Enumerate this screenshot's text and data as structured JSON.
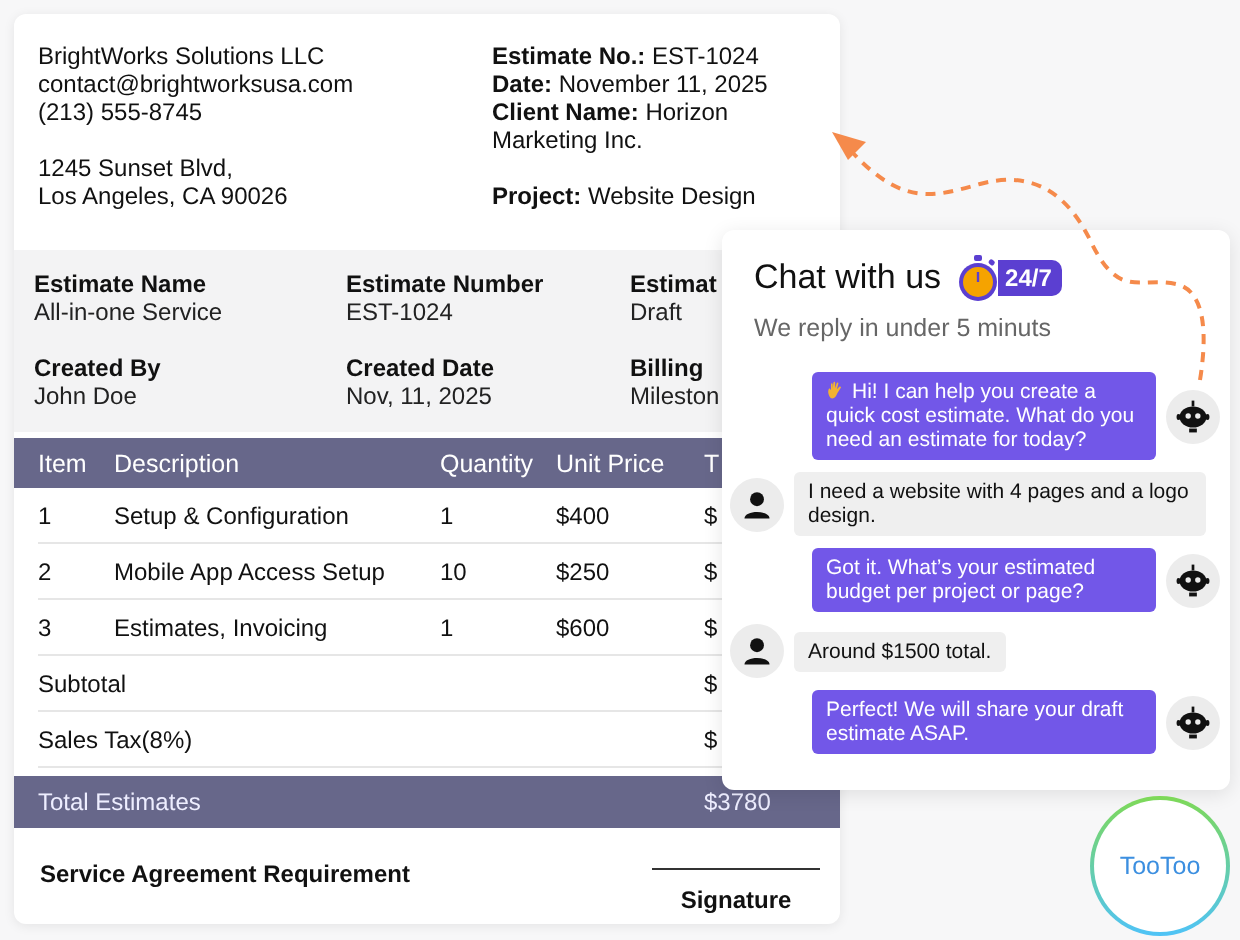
{
  "company": {
    "contact": [
      "BrightWorks Solutions LLC",
      "contact@brightworksusa.com",
      "(213) 555-8745"
    ],
    "address": [
      "1245 Sunset Blvd,",
      "Los Angeles, CA 90026"
    ]
  },
  "estimate_info": [
    "**Estimate No.:** EST-1024",
    "**Date:** November 11, 2025",
    "**Client Name:** Horizon Marketing Inc."
  ],
  "project": "**Project:** Website Design",
  "details": [
    {
      "label": "Estimate Name",
      "value": "All-in-one Service"
    },
    {
      "label": "Estimate Number",
      "value": "EST-1024"
    },
    {
      "label": "Estimat",
      "value": "Draft"
    },
    {
      "label": "Created By",
      "value": "John Doe"
    },
    {
      "label": "Created Date",
      "value": "Nov, 11, 2025"
    },
    {
      "label": "Billing",
      "value": "Mileston"
    }
  ],
  "table": {
    "columns": [
      "Item",
      "Description",
      "Quantity",
      "Unit Price",
      "T"
    ],
    "rows": [
      [
        "1",
        "Setup & Configuration",
        "1",
        "$400",
        "$"
      ],
      [
        "2",
        "Mobile App Access Setup",
        "10",
        "$250",
        "$"
      ],
      [
        "3",
        "Estimates, Invoicing",
        "1",
        "$600",
        "$"
      ]
    ],
    "summary": [
      {
        "label": "Subtotal",
        "value": "$"
      },
      {
        "label": "Sales Tax(8%)",
        "value": "$"
      }
    ],
    "total": {
      "label": "Total Estimates",
      "value": "$3780"
    }
  },
  "footer": {
    "requirement": "Service Agreement Requirement",
    "signature": "Signature"
  },
  "chat": {
    "title": "Chat with us",
    "badge": "24/7",
    "subtitle": "We reply in under 5 minuts",
    "messages": [
      {
        "kind": "bot",
        "greeting": true,
        "text": "Hi! I can help you create a quick cost estimate. What do you need an estimate for today?"
      },
      {
        "kind": "user",
        "text": "I need a website with 4 pages and a logo design."
      },
      {
        "kind": "bot",
        "greeting": false,
        "text": "Got it. What’s your estimated budget per project or page?"
      },
      {
        "kind": "user",
        "text": "Around $1500 total."
      },
      {
        "kind": "bot",
        "greeting": false,
        "text": "Perfect! We will share your draft estimate ASAP."
      }
    ]
  },
  "brand": "TooToo"
}
